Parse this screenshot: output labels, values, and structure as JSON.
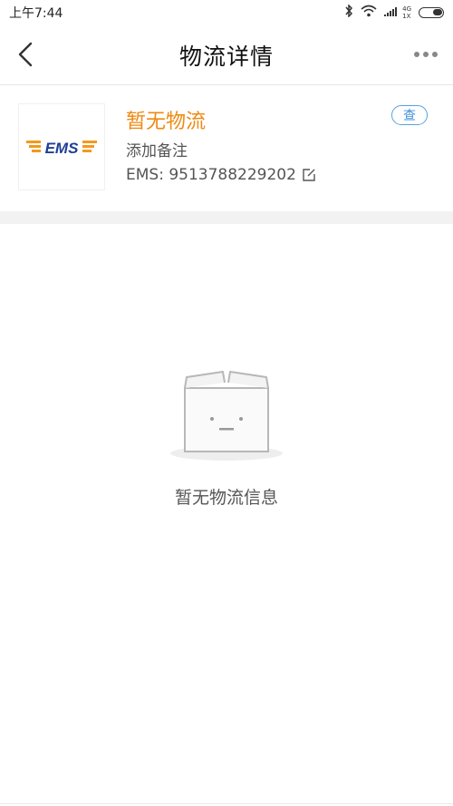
{
  "status_bar": {
    "time": "上午7:44",
    "network_type": "4G",
    "sim_label": "1X"
  },
  "nav": {
    "title": "物流详情"
  },
  "shipment": {
    "carrier_logo_text": "EMS",
    "status_title": "暂无物流",
    "remark": "添加备注",
    "tracking_label": "EMS: 9513788229202",
    "query_button": "查"
  },
  "empty_state": {
    "message": "暂无物流信息"
  },
  "colors": {
    "accent_orange": "#ee8a12",
    "link_blue": "#3f8fdc",
    "logo_orange": "#f39a1e",
    "logo_blue": "#1f3f96"
  }
}
